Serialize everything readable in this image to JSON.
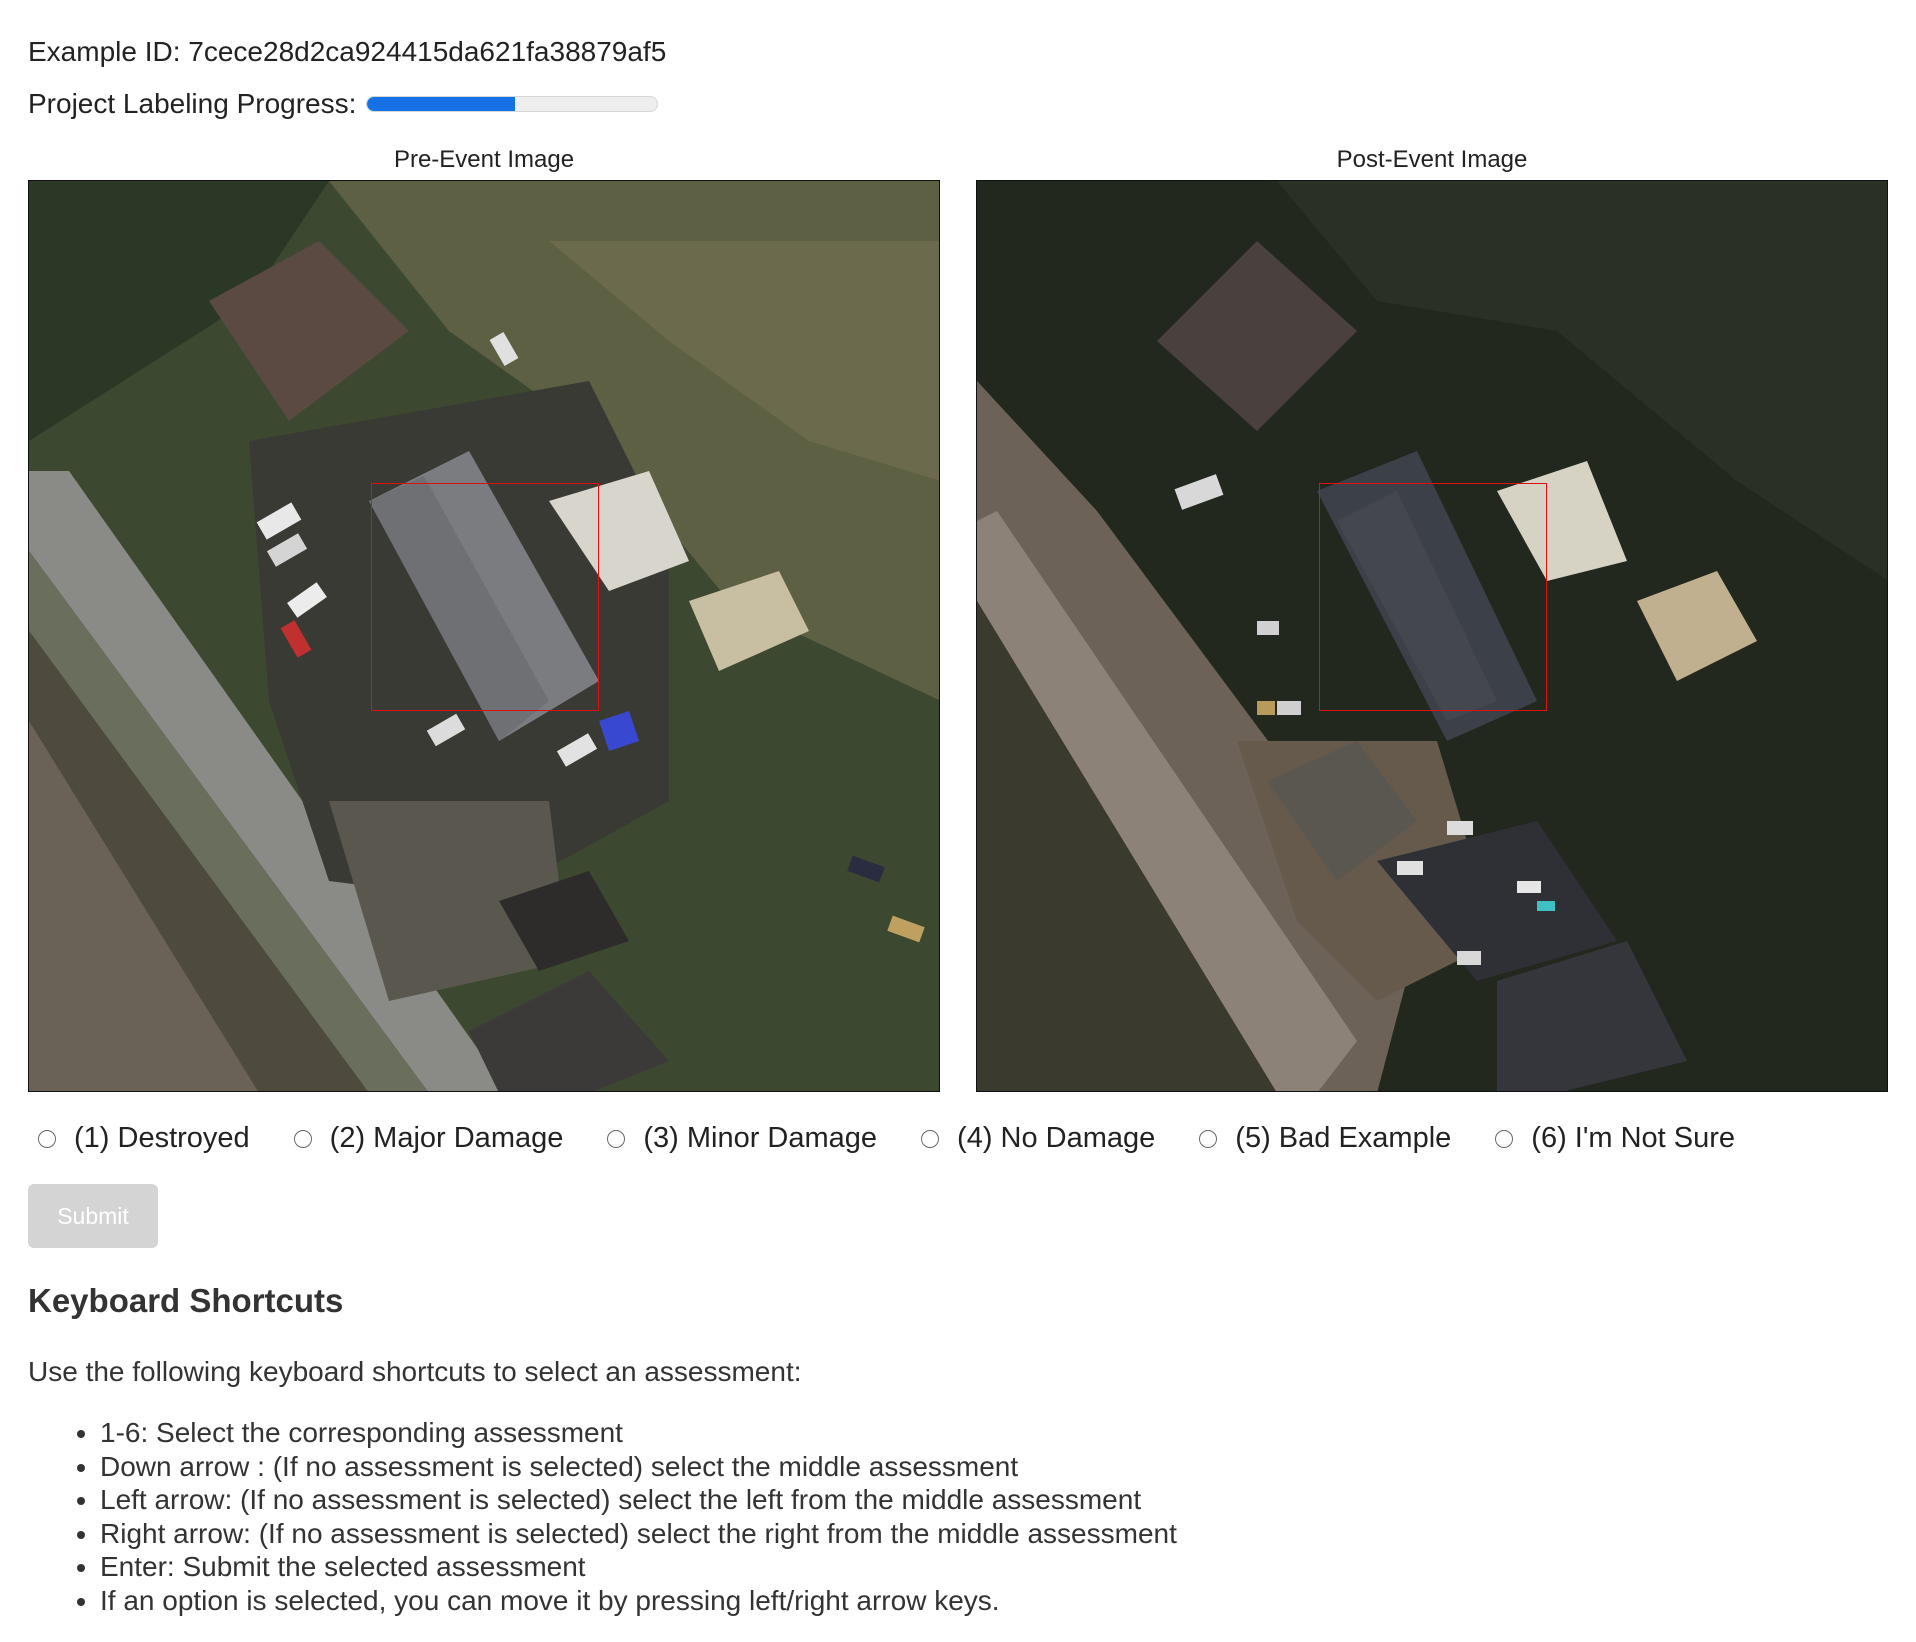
{
  "header": {
    "example_id_label": "Example ID: 7cece28d2ca924415da621fa38879af5",
    "progress_label": "Project Labeling Progress:",
    "progress_fraction": 0.51
  },
  "images": {
    "pre_label": "Pre-Event Image",
    "post_label": "Post-Event Image"
  },
  "options": [
    {
      "label": "(1) Destroyed"
    },
    {
      "label": "(2) Major Damage"
    },
    {
      "label": "(3) Minor Damage"
    },
    {
      "label": "(4) No Damage"
    },
    {
      "label": "(5) Bad Example"
    },
    {
      "label": "(6) I'm Not Sure"
    }
  ],
  "submit_label": "Submit",
  "shortcuts": {
    "title": "Keyboard Shortcuts",
    "intro": "Use the following keyboard shortcuts to select an assessment:",
    "items": [
      "1-6: Select the corresponding assessment",
      "Down arrow : (If no assessment is selected) select the middle assessment",
      "Left arrow: (If no assessment is selected) select the left from the middle assessment",
      "Right arrow: (If no assessment is selected) select the right from the middle assessment",
      "Enter: Submit the selected assessment",
      "If an option is selected, you can move it by pressing left/right arrow keys."
    ]
  },
  "colors": {
    "progress_fill": "#1670e6",
    "target_box": "#e01010",
    "submit_disabled": "#d4d4d4"
  }
}
